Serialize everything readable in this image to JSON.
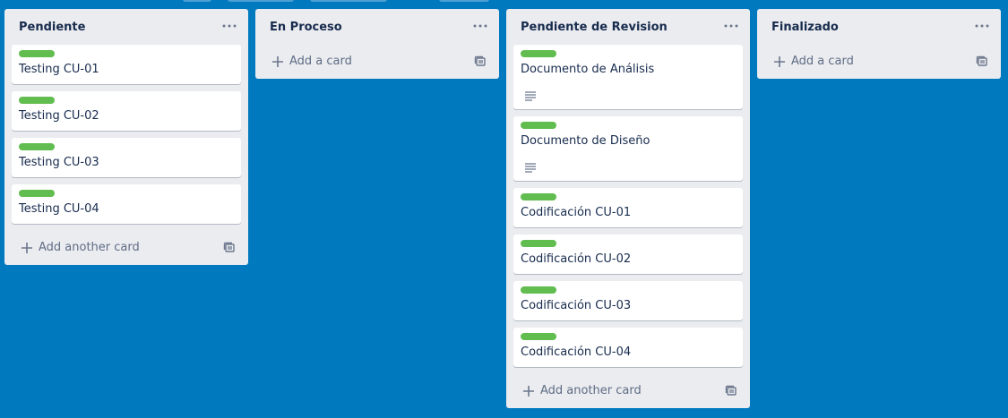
{
  "lists": [
    {
      "title": "Pendiente",
      "cards": [
        {
          "title": "Testing CU-01",
          "label_color": "#61bd4f",
          "has_description": false
        },
        {
          "title": "Testing CU-02",
          "label_color": "#61bd4f",
          "has_description": false
        },
        {
          "title": "Testing CU-03",
          "label_color": "#61bd4f",
          "has_description": false
        },
        {
          "title": "Testing CU-04",
          "label_color": "#61bd4f",
          "has_description": false
        }
      ],
      "add_label": "Add another card"
    },
    {
      "title": "En Proceso",
      "cards": [],
      "add_label": "Add a card"
    },
    {
      "title": "Pendiente de Revision",
      "cards": [
        {
          "title": "Documento de Análisis",
          "label_color": "#61bd4f",
          "has_description": true
        },
        {
          "title": "Documento de Diseño",
          "label_color": "#61bd4f",
          "has_description": true
        },
        {
          "title": "Codificación CU-01",
          "label_color": "#61bd4f",
          "has_description": false
        },
        {
          "title": "Codificación CU-02",
          "label_color": "#61bd4f",
          "has_description": false
        },
        {
          "title": "Codificación CU-03",
          "label_color": "#61bd4f",
          "has_description": false
        },
        {
          "title": "Codificación CU-04",
          "label_color": "#61bd4f",
          "has_description": false
        }
      ],
      "add_label": "Add another card"
    },
    {
      "title": "Finalizado",
      "cards": [],
      "add_label": "Add a card"
    }
  ],
  "colors": {
    "board_background": "#0079bf",
    "list_background": "#ebecf0",
    "label_green": "#61bd4f"
  },
  "icons": {
    "list_menu": "more-horizontal-icon",
    "add": "plus-icon",
    "template": "card-template-icon",
    "description": "description-icon"
  }
}
